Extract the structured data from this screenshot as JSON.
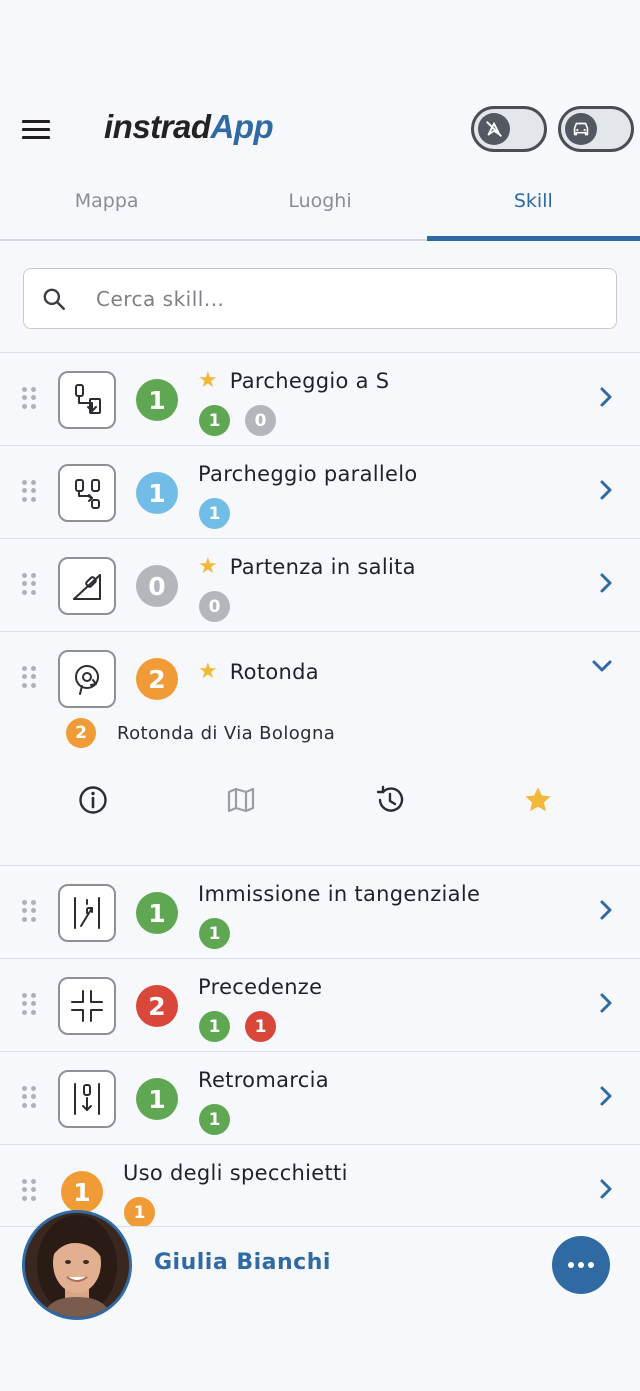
{
  "app": {
    "logo_part1": "instrad",
    "logo_part2": "App"
  },
  "tabs": [
    {
      "label": "Mappa",
      "active": false
    },
    {
      "label": "Luoghi",
      "active": false
    },
    {
      "label": "Skill",
      "active": true
    }
  ],
  "search": {
    "placeholder": "Cerca skill...",
    "value": ""
  },
  "skills": [
    {
      "title": "Parcheggio a S",
      "starred": true,
      "level": "1",
      "level_color": "green",
      "badges": [
        {
          "value": "1",
          "color": "green"
        },
        {
          "value": "0",
          "color": "grey"
        }
      ],
      "icon": "parking-s-icon"
    },
    {
      "title": "Parcheggio parallelo",
      "starred": false,
      "level": "1",
      "level_color": "blue",
      "badges": [
        {
          "value": "1",
          "color": "blue"
        }
      ],
      "icon": "parallel-parking-icon"
    },
    {
      "title": "Partenza in salita",
      "starred": true,
      "level": "0",
      "level_color": "grey",
      "badges": [
        {
          "value": "0",
          "color": "grey"
        }
      ],
      "icon": "uphill-start-icon"
    },
    {
      "title": "Rotonda",
      "starred": true,
      "level": "2",
      "level_color": "orange",
      "expanded": true,
      "icon": "roundabout-icon",
      "sub_item": {
        "value": "2",
        "color": "orange",
        "label": "Rotonda di Via Bologna"
      }
    },
    {
      "title": "Immissione in tangenziale",
      "starred": false,
      "level": "1",
      "level_color": "green",
      "badges": [
        {
          "value": "1",
          "color": "green"
        }
      ],
      "icon": "highway-merge-icon"
    },
    {
      "title": "Precedenze",
      "starred": false,
      "level": "2",
      "level_color": "red",
      "badges": [
        {
          "value": "1",
          "color": "green"
        },
        {
          "value": "1",
          "color": "red"
        }
      ],
      "icon": "intersection-icon"
    },
    {
      "title": "Retromarcia",
      "starred": false,
      "level": "1",
      "level_color": "green",
      "badges": [
        {
          "value": "1",
          "color": "green"
        }
      ],
      "icon": "reverse-icon"
    },
    {
      "title": "Uso degli specchietti",
      "starred": false,
      "level": "1",
      "level_color": "orange",
      "badges": [
        {
          "value": "1",
          "color": "orange"
        }
      ],
      "icon": "mirrors-icon"
    }
  ],
  "footer": {
    "user_name": "Giulia Bianchi"
  },
  "colors": {
    "accent": "#2f6aa3",
    "green": "#5fa752",
    "blue": "#72bde8",
    "grey": "#b3b6ba",
    "orange": "#f09b35",
    "red": "#d8473a",
    "star": "#f2b83a"
  }
}
